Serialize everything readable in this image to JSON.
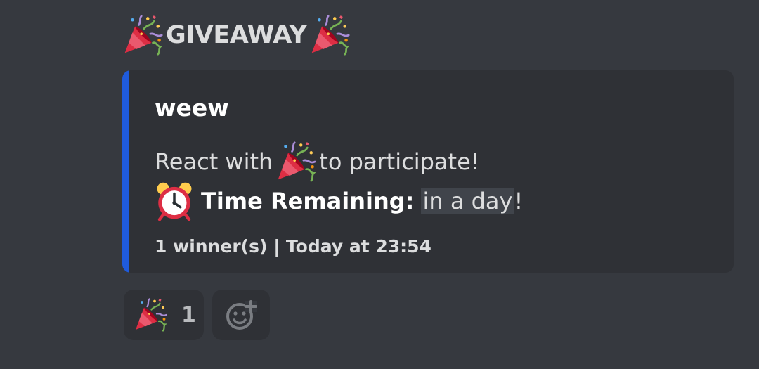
{
  "heading": {
    "text": "GIVEAWAY",
    "icon_left": "party-popper-icon",
    "icon_right": "party-popper-icon"
  },
  "embed": {
    "accent_color": "#1f5bdc",
    "title": "weew",
    "participate_before": "React with",
    "participate_icon": "party-popper-icon",
    "participate_after": "to participate!",
    "time_icon": "alarm-clock-icon",
    "time_label": "Time Remaining:",
    "time_value": "in a day",
    "time_suffix": "!",
    "footer": "1 winner(s) | Today at 23:54"
  },
  "reactions": {
    "items": [
      {
        "icon": "party-popper-icon",
        "count": "1"
      }
    ],
    "add_icon": "add-reaction-icon"
  },
  "colors": {
    "background": "#36393f",
    "embed_background": "#2f3136",
    "text": "#dcddde"
  }
}
